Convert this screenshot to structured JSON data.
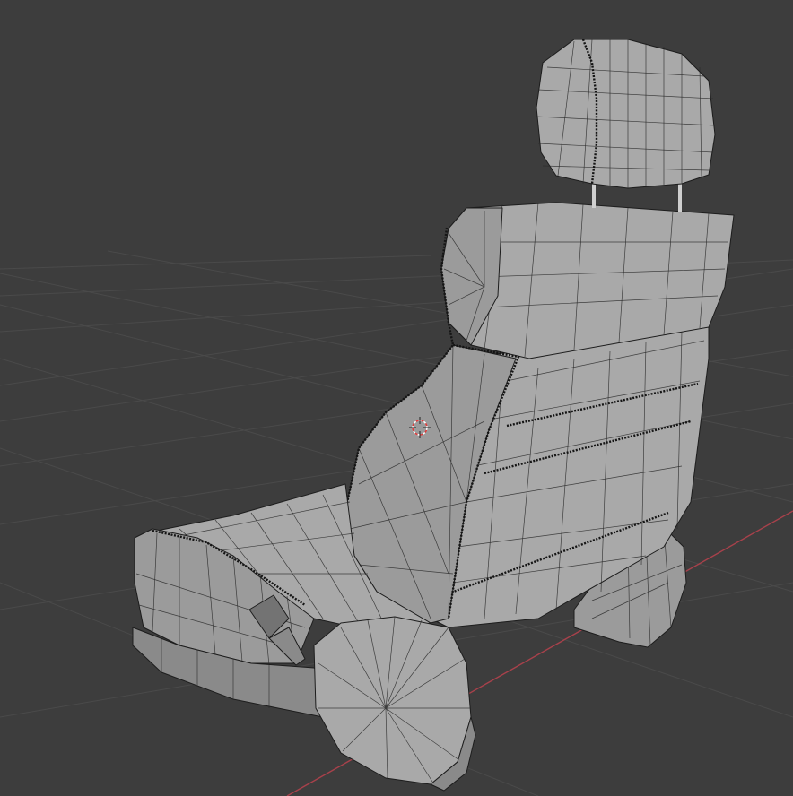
{
  "viewport": {
    "background": "#3d3d3d",
    "grid_color": "#4a4a4a",
    "x_axis_color": "#a8414b",
    "object": "car-seat-mesh",
    "shading": "solid-wireframe"
  },
  "cursor_3d": {
    "icon": "3d-cursor-icon",
    "colors": [
      "#e03a3a",
      "#ffffff"
    ]
  }
}
